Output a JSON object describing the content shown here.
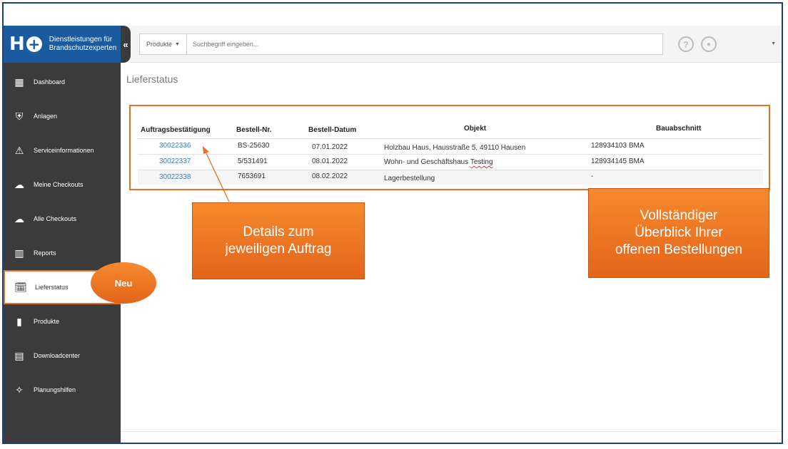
{
  "logo": {
    "mark": "H",
    "line1": "Dienstleistungen für",
    "line2": "Brandschutzexperten"
  },
  "collapse_glyph": "«",
  "sidebar": {
    "items": [
      {
        "label": "Dashboard",
        "icon": "grid-icon",
        "glyph": "▦"
      },
      {
        "label": "Anlagen",
        "icon": "shield-icon",
        "glyph": "⛨"
      },
      {
        "label": "Serviceinformationen",
        "icon": "warning-icon",
        "glyph": "⚠"
      },
      {
        "label": "Meine Checkouts",
        "icon": "cloud-download-icon",
        "glyph": "☁"
      },
      {
        "label": "Alle Checkouts",
        "icon": "cloud-download-icon",
        "glyph": "☁"
      },
      {
        "label": "Reports",
        "icon": "bar-chart-icon",
        "glyph": "▥"
      },
      {
        "label": "Lieferstatus",
        "icon": "calendar-clock-icon",
        "glyph": "🗓",
        "active": true
      },
      {
        "label": "Produkte",
        "icon": "barcode-icon",
        "glyph": "▮"
      },
      {
        "label": "Downloadcenter",
        "icon": "document-icon",
        "glyph": "▤"
      },
      {
        "label": "Planungshilfen",
        "icon": "compass-icon",
        "glyph": "✧"
      }
    ]
  },
  "search": {
    "category": "Produkte",
    "placeholder": "Suchbegriff eingeben..."
  },
  "header_icons": {
    "help": "?",
    "user": "●"
  },
  "page_title": "Lieferstatus",
  "table": {
    "headers": [
      "Auftragsbestätigung",
      "Bestell-Nr.",
      "Bestell-Datum",
      "Objekt",
      "Bauabschnitt"
    ],
    "rows": [
      {
        "auftrag": "30022336",
        "bestell_nr": "BS-25630",
        "datum": "07.01.2022",
        "objekt": "Holzbau Haus, Hausstraße 5, 49110 Hausen",
        "bauabschnitt": "128934103 BMA"
      },
      {
        "auftrag": "30022337",
        "bestell_nr": "5/531491",
        "datum": "08.01.2022",
        "objekt_a": "Wohn- und Geschäftshaus ",
        "objekt_b": "Testing",
        "bauabschnitt": "128934145 BMA"
      },
      {
        "auftrag": "30022338",
        "bestell_nr": "7653691",
        "datum": "08.02.2022",
        "objekt": "Lagerbestellung",
        "bauabschnitt": "-"
      }
    ]
  },
  "annotations": {
    "details_line1": "Details zum",
    "details_line2": "jeweiligen Auftrag",
    "overview_line1": "Vollständiger",
    "overview_line2": "Überblick Ihrer",
    "overview_line3": "offenen Bestellungen",
    "badge": "Neu"
  }
}
